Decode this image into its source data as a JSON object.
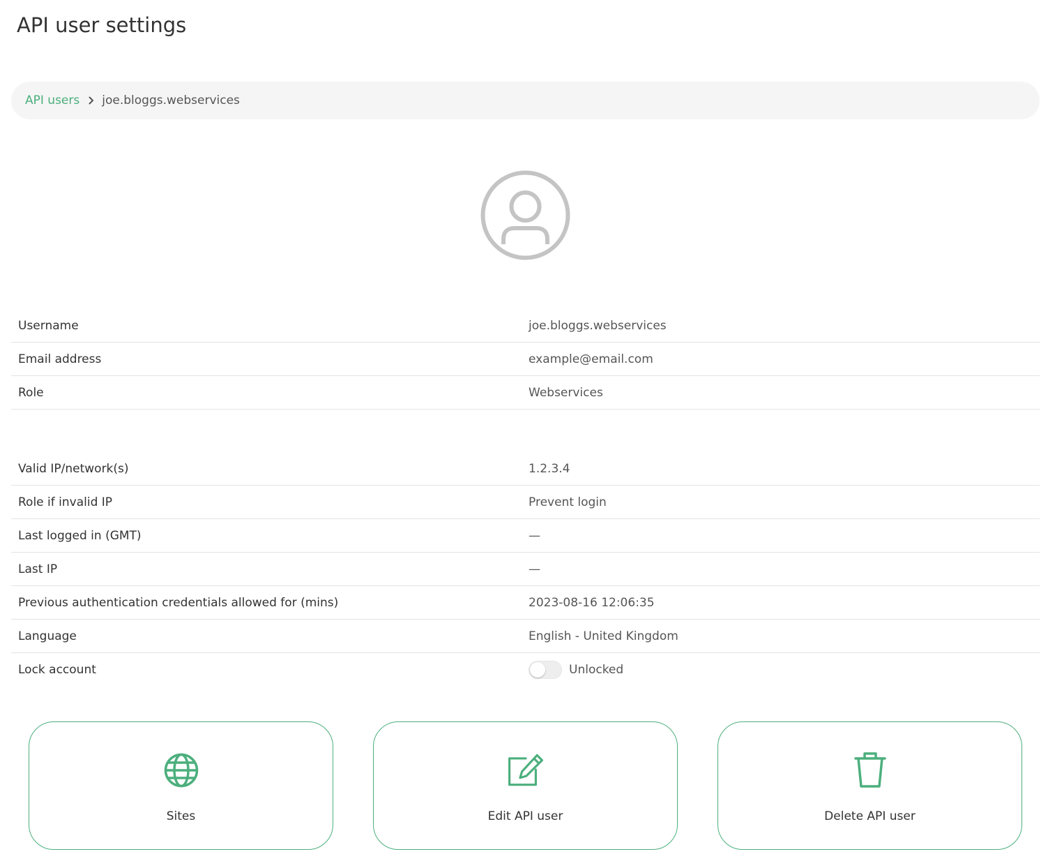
{
  "page": {
    "title": "API user settings"
  },
  "breadcrumb": {
    "parent_label": "API users",
    "current_label": "joe.bloggs.webservices"
  },
  "details": {
    "username": {
      "label": "Username",
      "value": "joe.bloggs.webservices"
    },
    "email": {
      "label": "Email address",
      "value": "example@email.com"
    },
    "role": {
      "label": "Role",
      "value": "Webservices"
    },
    "valid_ip": {
      "label": "Valid IP/network(s)",
      "value": "1.2.3.4"
    },
    "role_invalid_ip": {
      "label": "Role if invalid IP",
      "value": "Prevent login"
    },
    "last_logged_in": {
      "label": "Last logged in (GMT)",
      "value": "—"
    },
    "last_ip": {
      "label": "Last IP",
      "value": "—"
    },
    "prev_credentials": {
      "label": "Previous authentication credentials allowed for (mins)",
      "value": "2023-08-16 12:06:35"
    },
    "language": {
      "label": "Language",
      "value": "English - United Kingdom"
    },
    "lock_account": {
      "label": "Lock account",
      "value": "Unlocked",
      "locked": false
    }
  },
  "actions": {
    "sites": {
      "label": "Sites",
      "icon": "globe-icon"
    },
    "edit": {
      "label": "Edit API user",
      "icon": "edit-icon"
    },
    "delete": {
      "label": "Delete API user",
      "icon": "trash-icon"
    }
  },
  "colors": {
    "accent": "#4caf7d",
    "avatar": "#c4c4c4",
    "breadcrumb_bg": "#f5f5f5",
    "divider": "#e3e3e3"
  }
}
